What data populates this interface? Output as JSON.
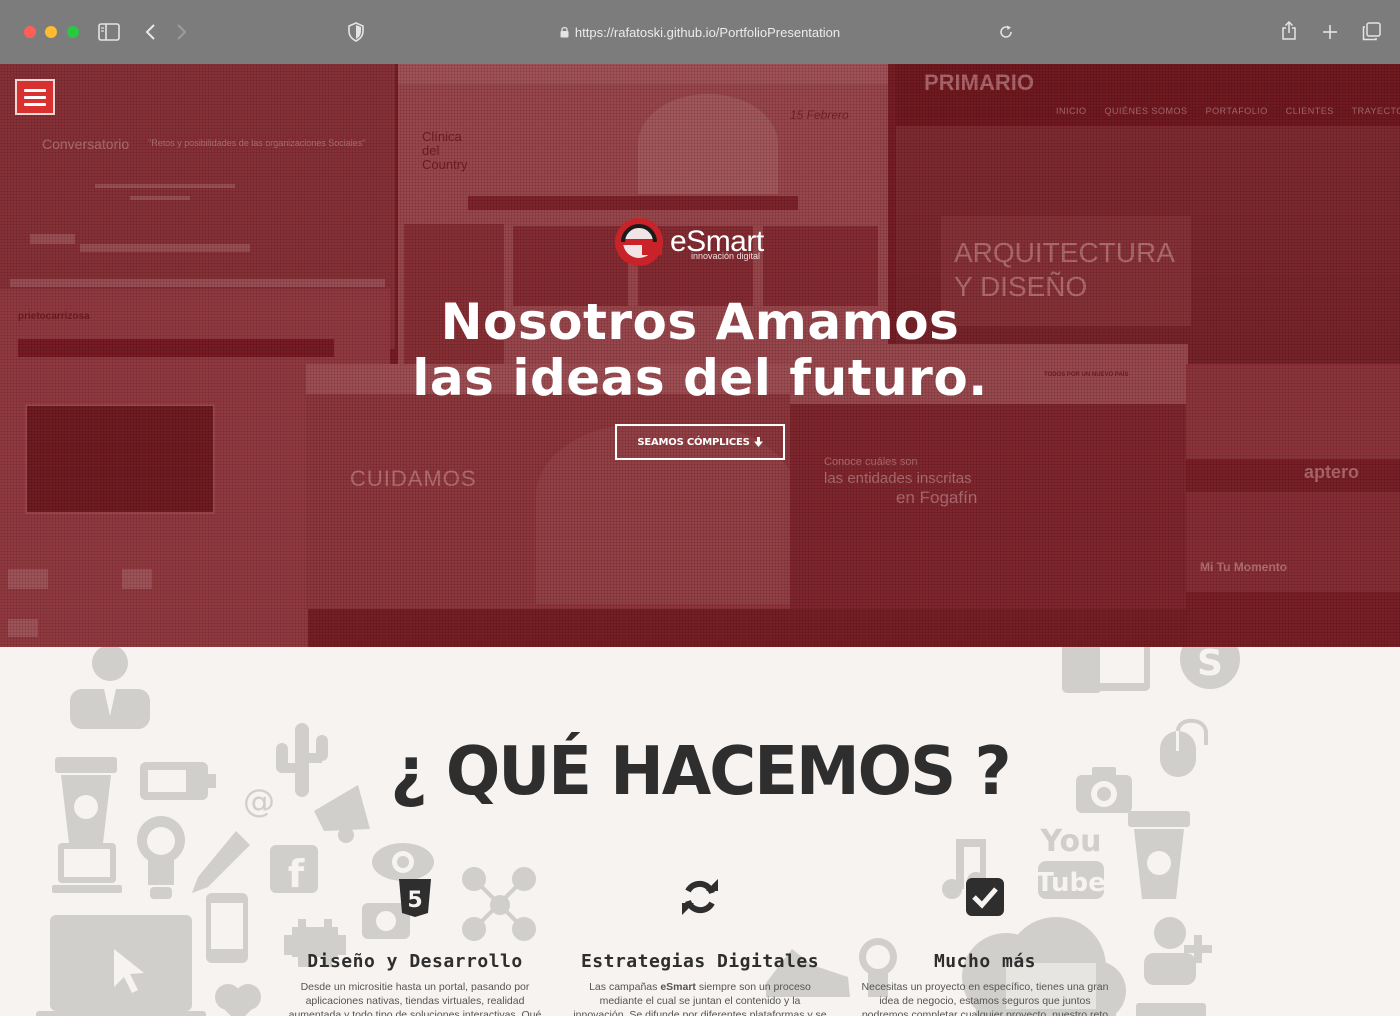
{
  "browser": {
    "url": "https://rafatoski.github.io/PortfolioPresentation",
    "icons": [
      "sidebar-icon",
      "back-icon",
      "forward-icon",
      "shield-icon",
      "lock-icon",
      "reload-icon",
      "share-icon",
      "new-tab-icon",
      "tabs-icon"
    ]
  },
  "hero": {
    "brand_name": "eSmart",
    "brand_tagline": "innovación digital",
    "title_line1": "Nosotros Amamos",
    "title_line2": "las ideas del futuro.",
    "cta_label": "SEAMOS CÓMPLICES",
    "cta_icon": "arrow-down-icon",
    "overlay_color": "#8a1f28",
    "background_screens": {
      "s1": {
        "name": "Conversatorio",
        "line": "\"Retos y posibilidades de las organizaciones Sociales\""
      },
      "s2": {
        "name": "prietocarrizosa"
      },
      "s3": {
        "name": "Clínica del Country",
        "date": "15 Febrero"
      },
      "s4": {
        "name": "PRIMARIO",
        "heading": "ARQUITECTURA Y DISEÑO",
        "nav": [
          "INICIO",
          "QUIÉNES SOMOS",
          "PORTAFOLIO",
          "CLIENTES",
          "TRAYECTORIA"
        ]
      },
      "s5": {
        "name": "CUIDAMOS"
      },
      "s6": {
        "line1": "Conoce cuáles son",
        "line2": "las entidades inscritas",
        "line3": "en Fogafín",
        "badge": "TODOS POR UN NUEVO PAÍS"
      },
      "s7": {
        "name": "aptero",
        "sub": "Mi Tu Momento"
      }
    }
  },
  "services": {
    "title": "¿ QUÉ HACEMOS ?",
    "items": [
      {
        "icon": "html5-icon",
        "title": "Diseño y Desarrollo",
        "text": "Desde un micrositie hasta un portal, pasando por aplicaciones nativas, tiendas virtuales, realidad aumentada y todo tipo de soluciones interactivas. Qué"
      },
      {
        "icon": "refresh-icon",
        "title": "Estrategias Digitales",
        "text_before": "Las campañas ",
        "text_bold": "eSmart",
        "text_after": " siempre son un proceso mediante el cual se juntan el contenido y la innovación. Se difunde por diferentes plataformas y se llega a la"
      },
      {
        "icon": "checkbox-icon",
        "title": "Mucho más",
        "text": "Necesitas un proyecto en específico, tienes una gran idea de negocio, estamos seguros que juntos podremos completar cualquier proyecto, nuestro reto"
      }
    ]
  },
  "colors": {
    "menu_button": "#d8312f",
    "brand_red": "#c92229",
    "services_bg": "#f6f3f0",
    "heading": "#2e2e2e"
  }
}
